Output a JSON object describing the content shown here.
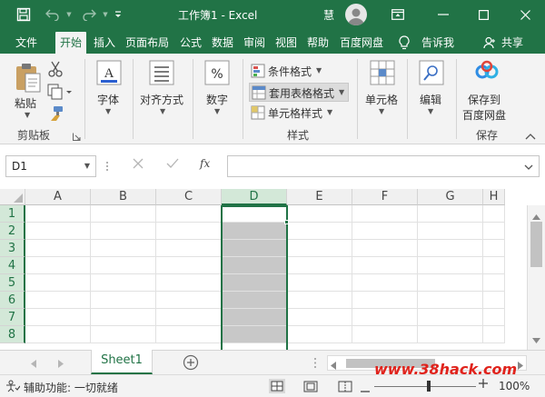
{
  "colors": {
    "accent": "#217346",
    "selection": "#217346",
    "selected_cells": "#c8c8c8"
  },
  "titlebar": {
    "title": "工作簿1 - Excel",
    "user": "慧"
  },
  "tabs": [
    "文件",
    "开始",
    "插入",
    "页面布局",
    "公式",
    "数据",
    "审阅",
    "视图",
    "帮助",
    "百度网盘",
    "告诉我",
    "共享"
  ],
  "ribbon": {
    "clipboard": {
      "paste": "粘贴",
      "group": "剪贴板"
    },
    "font": {
      "label": "字体"
    },
    "align": {
      "label": "对齐方式"
    },
    "number": {
      "label": "数字"
    },
    "styles": {
      "cond": "条件格式",
      "table": "套用表格格式",
      "cell": "单元格样式",
      "group": "样式"
    },
    "cells": {
      "label": "单元格"
    },
    "edit": {
      "label": "编辑"
    },
    "save": {
      "line1": "保存到",
      "line2": "百度网盘",
      "group": "保存"
    }
  },
  "formula_bar": {
    "name_box": "D1",
    "fx": "fx",
    "content": ""
  },
  "grid": {
    "columns": [
      "A",
      "B",
      "C",
      "D",
      "E",
      "F",
      "G",
      "H"
    ],
    "rows": [
      "1",
      "2",
      "3",
      "4",
      "5",
      "6",
      "7",
      "8"
    ],
    "selected_column": "D"
  },
  "sheets": {
    "active": "Sheet1"
  },
  "status": {
    "accessibility": "辅助功能: 一切就绪",
    "zoom": "100%",
    "watermark": "www.38hack.com"
  }
}
